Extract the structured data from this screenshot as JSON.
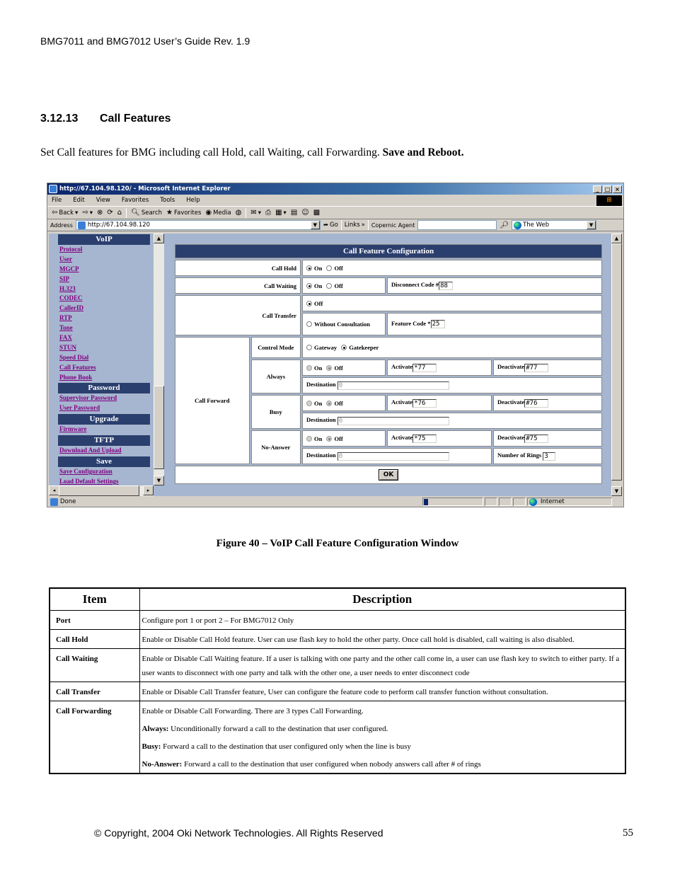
{
  "document": {
    "running_header": "BMG7011 and BMG7012 User’s Guide Rev. 1.9",
    "section_number": "3.12.13",
    "section_title": "Call Features",
    "intro_text": "Set Call features for BMG including call Hold, call Waiting, call Forwarding. ",
    "intro_bold": "Save and Reboot.",
    "figure_caption": "Figure 40 – VoIP Call Feature Configuration Window",
    "footer": "© Copyright, 2004 Oki Network Technologies. All Rights Reserved",
    "page_number": "55"
  },
  "browser": {
    "title": "http://67.104.98.120/ - Microsoft Internet Explorer",
    "menu": [
      "File",
      "Edit",
      "View",
      "Favorites",
      "Tools",
      "Help"
    ],
    "toolbar": {
      "back": "Back",
      "search": "Search",
      "favorites": "Favorites",
      "media": "Media"
    },
    "address_label": "Address",
    "address_value": "http://67.104.98.120",
    "go_label": "Go",
    "links_label": "Links",
    "copernic_label": "Copernic Agent",
    "copernic_value": "",
    "search_scope": "The Web",
    "status_text": "Done",
    "zone_text": "Internet"
  },
  "nav": {
    "sections": [
      {
        "title": "VoIP",
        "links": [
          "Protocol",
          "User",
          "MGCP",
          "SIP",
          "H.323",
          "CODEC",
          "CallerID",
          "RTP",
          "Tone",
          "FAX",
          "STUN",
          "Speed Dial",
          "Call Features",
          "Phone Book"
        ]
      },
      {
        "title": "Password",
        "links": [
          "Supervisor Password",
          "User Password"
        ]
      },
      {
        "title": "Upgrade",
        "links": [
          "Firmware"
        ]
      },
      {
        "title": "TFTP",
        "links": [
          "Download And Upload"
        ]
      },
      {
        "title": "Save",
        "links": [
          "Save Configuration",
          "Load Default Settings"
        ]
      }
    ]
  },
  "config": {
    "title": "Call Feature Configuration",
    "call_hold": {
      "label": "Call Hold",
      "on_label": "On",
      "off_label": "Off",
      "selected": "On"
    },
    "call_waiting": {
      "label": "Call Waiting",
      "on_label": "On",
      "off_label": "Off",
      "selected": "On",
      "disconnect_label": "Disconnect Code #",
      "disconnect_value": "88"
    },
    "call_transfer": {
      "label": "Call Transfer",
      "off_label": "Off",
      "without_label": "Without Consultation",
      "selected": "Off",
      "feature_code_label": "Feature Code *",
      "feature_code_value": "25"
    },
    "call_forward": {
      "label": "Call Forward",
      "control_mode_label": "Control Mode",
      "gateway_label": "Gateway",
      "gatekeeper_label": "Gatekeeper",
      "control_mode_selected": "Gatekeeper",
      "on_label": "On",
      "off_label": "Off",
      "activate_label": "Activate",
      "deactivate_label": "Deactivate",
      "destination_label": "Destination",
      "rings_label": "Number of Rings",
      "always": {
        "label": "Always",
        "selected": "Off",
        "activate": "*77",
        "deactivate": "#77",
        "destination": "0"
      },
      "busy": {
        "label": "Busy",
        "selected": "Off",
        "activate": "*76",
        "deactivate": "#76",
        "destination": "0"
      },
      "no_answer": {
        "label": "No-Answer",
        "selected": "Off",
        "activate": "*75",
        "deactivate": "#75",
        "destination": "0",
        "rings": "3"
      }
    },
    "ok_label": "OK"
  },
  "desc_table": {
    "headers": [
      "Item",
      "Description"
    ],
    "rows": [
      {
        "item": "Port",
        "desc": [
          "Configure port 1 or port 2 – For BMG7012 Only"
        ]
      },
      {
        "item": "Call Hold",
        "desc": [
          "Enable or Disable Call Hold feature. User can use flash key to hold the other party. Once call hold is disabled, call waiting is also disabled."
        ]
      },
      {
        "item": "Call Waiting",
        "desc": [
          "Enable or Disable Call Waiting feature. If a user is talking with one party and the other call come in, a user can use flash key to switch to either party. If a user wants to disconnect with one party and talk with the other one, a user needs to enter disconnect code"
        ]
      },
      {
        "item": "Call Transfer",
        "desc": [
          "Enable or Disable Call Transfer feature, User can configure the feature code to perform call transfer function without consultation."
        ]
      },
      {
        "item": "Call Forwarding",
        "desc": [
          "Enable or Disable Call Forwarding. There are 3 types Call Forwarding."
        ],
        "sub": [
          {
            "term": "Always:",
            "text": " Unconditionally forward a call to the destination that user configured."
          },
          {
            "term": "Busy:",
            "text": " Forward a call to the destination that user configured only when the line is busy"
          },
          {
            "term": "No-Answer:",
            "text": " Forward a call to the destination that user configured when nobody answers call after # of rings"
          }
        ]
      }
    ]
  }
}
